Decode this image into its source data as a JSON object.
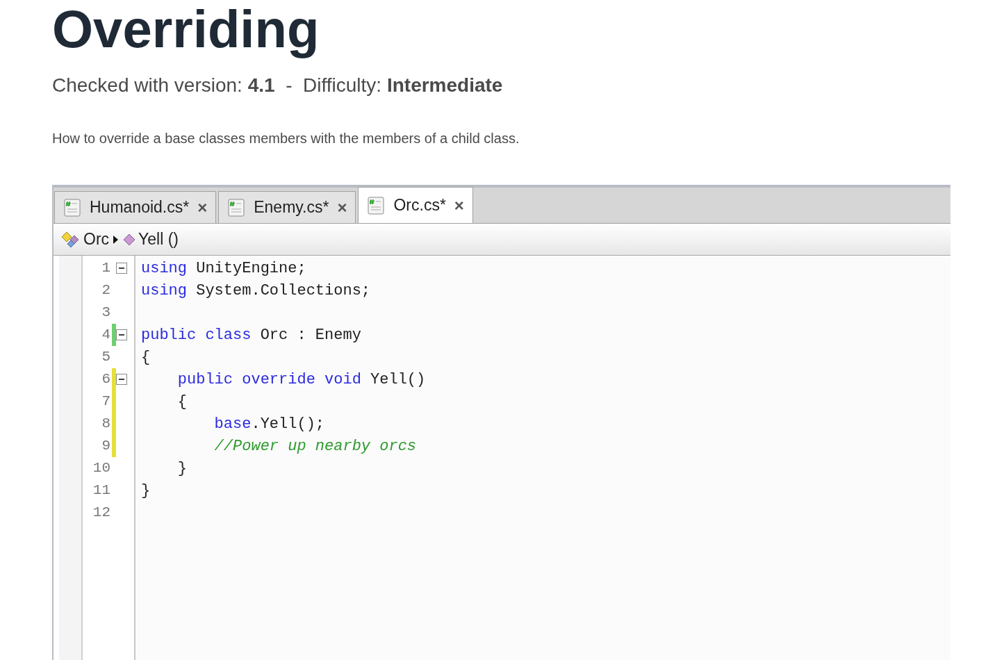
{
  "title": "Overriding",
  "meta": "Checked with version: **4.1**  -  Difficulty: **Intermediate**",
  "description": "How to override a base classes members with the members of a child class.",
  "editor": {
    "tabs": [
      {
        "label": "Humanoid.cs*",
        "close": "×",
        "selected": false
      },
      {
        "label": "Enemy.cs*",
        "close": "×",
        "selected": false
      },
      {
        "label": "Orc.cs*",
        "close": "×",
        "selected": true
      }
    ],
    "breadcrumb": [
      {
        "label": "Orc",
        "kind": "class"
      },
      {
        "label": "Yell ()",
        "kind": "method"
      }
    ],
    "lines": [
      {
        "number": "1",
        "collapsible": true,
        "tokens": [
          {
            "kind": "keyword",
            "text": "using"
          },
          {
            "kind": "plain",
            "text": " UnityEngine;"
          }
        ]
      },
      {
        "number": "2",
        "collapsible": false,
        "tokens": [
          {
            "kind": "keyword",
            "text": "using"
          },
          {
            "kind": "plain",
            "text": " System.Collections;"
          }
        ]
      },
      {
        "number": "3",
        "collapsible": false
      },
      {
        "number": "4",
        "collapsible": true,
        "color": "#6fcf6f",
        "tokens": [
          {
            "kind": "keyword",
            "text": "public class"
          },
          {
            "kind": "plain",
            "text": " Orc : Enemy"
          }
        ]
      },
      {
        "number": "5",
        "collapsible": false,
        "tokens": [
          {
            "kind": "plain",
            "text": "{"
          }
        ]
      },
      {
        "number": "6",
        "collapsible": true,
        "color": "#e6e03c",
        "tokens": [
          {
            "kind": "keyword",
            "text": "    public override void"
          },
          {
            "kind": "plain",
            "text": " Yell()"
          }
        ]
      },
      {
        "number": "7",
        "collapsible": false,
        "color": "#e6e03c",
        "tokens": [
          {
            "kind": "plain",
            "text": "    {"
          }
        ]
      },
      {
        "number": "8",
        "collapsible": false,
        "color": "#e6e03c",
        "tokens": [
          {
            "kind": "keyword",
            "text": "        base"
          },
          {
            "kind": "plain",
            "text": ".Yell();"
          }
        ]
      },
      {
        "number": "9",
        "collapsible": false,
        "color": "#e6e03c",
        "tokens": [
          {
            "kind": "comment",
            "text": "        //Power up nearby orcs"
          }
        ]
      },
      {
        "number": "10",
        "collapsible": false,
        "tokens": [
          {
            "kind": "plain",
            "text": "    }"
          }
        ]
      },
      {
        "number": "11",
        "collapsible": false,
        "tokens": [
          {
            "kind": "plain",
            "text": "}"
          }
        ]
      },
      {
        "number": "12",
        "collapsible": false
      }
    ]
  }
}
